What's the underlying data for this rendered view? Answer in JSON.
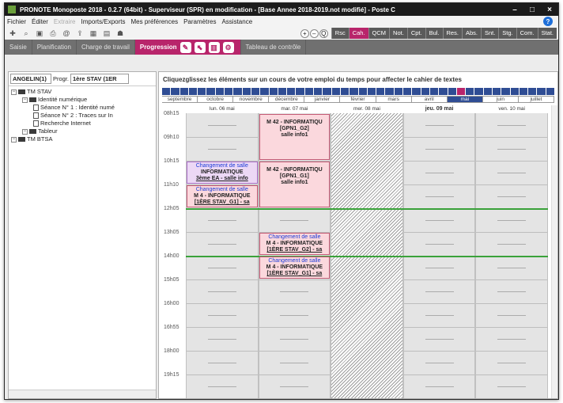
{
  "window": {
    "title": "PRONOTE Monoposte 2018 - 0.2.7 (64bit) - Superviseur (SPR) en modification - [Base Annee 2018-2019.not modifié] - Poste C",
    "minimize": "–",
    "maximize": "□",
    "close": "×"
  },
  "menu": {
    "items": [
      "Fichier",
      "Éditer",
      "Extraire",
      "Imports/Exports",
      "Mes préférences",
      "Paramètres",
      "Assistance"
    ],
    "help": "?"
  },
  "toolbar": {
    "icons": [
      "new-icon",
      "search-icon",
      "save-icon",
      "print-icon",
      "email-icon",
      "export-icon",
      "grid-icon",
      "delete-icon",
      "users-icon"
    ],
    "zoom": [
      "+",
      "–",
      "Q"
    ],
    "modules": [
      "Rsc",
      "Cah.",
      "QCM",
      "Not.",
      "Cpt.",
      "Bul.",
      "Res.",
      "Abs.",
      "Snt.",
      "Stg.",
      "Com.",
      "Stat."
    ],
    "active_module": "Cah."
  },
  "navbar": {
    "tabs": [
      "Saisie",
      "Planification",
      "Charge de travail",
      "Progression",
      "Tableau de contrôle"
    ],
    "active": "Progression"
  },
  "left": {
    "teacher": "ANGELIN(1)",
    "progression_label": "Progr.",
    "class_select": "1ère STAV (1ER",
    "tree": [
      {
        "label": "TM STAV",
        "level": 0,
        "type": "folder"
      },
      {
        "label": "Identité numérique",
        "level": 1,
        "type": "folder"
      },
      {
        "label": "Séance N° 1 : Identité numé",
        "level": 2,
        "type": "doc"
      },
      {
        "label": "Séance N° 2 : Traces sur In",
        "level": 2,
        "type": "doc"
      },
      {
        "label": "Recherche Internet",
        "level": 2,
        "type": "doc"
      },
      {
        "label": "Tableur",
        "level": 1,
        "type": "folder"
      },
      {
        "label": "TM BTSA",
        "level": 0,
        "type": "folder"
      }
    ]
  },
  "right": {
    "instruction": "Cliquezglissez les éléments sur un cours de votre emploi du temps pour affecter le cahier de textes",
    "months": [
      "septembre",
      "octobre",
      "novembre",
      "décembre",
      "janvier",
      "février",
      "mars",
      "avril",
      "mai",
      "juin",
      "juillet"
    ],
    "active_month": "mai",
    "days": [
      "lun. 06 mai",
      "mar. 07 mai",
      "mer. 08 mai",
      "jeu. 09 mai",
      "ven. 10 mai"
    ],
    "today_index": 3,
    "times": [
      "08h15",
      "09h10",
      "10h15",
      "11h10",
      "12h05",
      "13h05",
      "14h00",
      "15h05",
      "16h00",
      "16h55",
      "18h00",
      "19h15"
    ],
    "courses": [
      {
        "day": 1,
        "start": 0,
        "end": 2,
        "type": "pink",
        "change": "",
        "subject": "M 42 - INFORMATIQU",
        "group": "[GPN1_G2]",
        "room": "salle info1"
      },
      {
        "day": 1,
        "start": 2,
        "end": 4,
        "type": "pink",
        "change": "",
        "subject": "M 42 - INFORMATIQU",
        "group": "[GPN1_G1]",
        "room": "salle info1"
      },
      {
        "day": 0,
        "start": 2,
        "end": 3,
        "type": "purple",
        "change": "Changement de salle",
        "subject": "INFORMATIQUE",
        "group": "3ème EA - salle info",
        "room": ""
      },
      {
        "day": 0,
        "start": 3,
        "end": 4,
        "type": "pink",
        "change": "Changement de salle",
        "subject": "M 4 - INFORMATIQUE",
        "group": "[1ÈRE STAV_G1] - sa",
        "room": ""
      },
      {
        "day": 1,
        "start": 5,
        "end": 6,
        "type": "pink",
        "change": "Changement de salle",
        "subject": "M 4 - INFORMATIQUE",
        "group": "[1ÈRE STAV_G2] - sa",
        "room": ""
      },
      {
        "day": 1,
        "start": 6,
        "end": 7,
        "type": "pink",
        "change": "Changement de salle",
        "subject": "M 4 - INFORMATIQUE",
        "group": "[1ÈRE STAV_G1] - sa",
        "room": ""
      }
    ],
    "hatched_day": 2,
    "green_lines_at": [
      4,
      6
    ]
  }
}
